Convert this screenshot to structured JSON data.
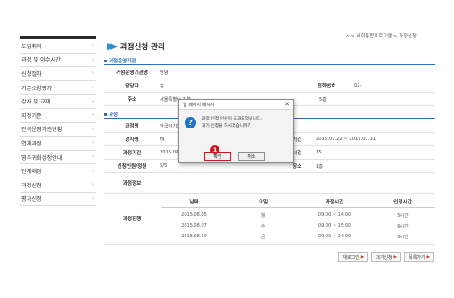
{
  "breadcrumb": "⌂ > 사회통합프로그램 > 과정신청",
  "page_title": "과정신청 관리",
  "sidebar": {
    "items": [
      {
        "label": "도입취지"
      },
      {
        "label": "과정 및 이수시간"
      },
      {
        "label": "신청절차"
      },
      {
        "label": "기본소양평가"
      },
      {
        "label": "강사 및 교재"
      },
      {
        "label": "지정기준"
      },
      {
        "label": "전국운영기관현황"
      },
      {
        "label": "연계과정"
      },
      {
        "label": "영주귀화심청안내"
      },
      {
        "label": "단계배정"
      },
      {
        "label": "과정신청"
      },
      {
        "label": "평가신청"
      }
    ]
  },
  "institution": {
    "section_title": "거점운영기관",
    "rows": [
      {
        "label": "거점운영기관명",
        "value": "안녕"
      },
      {
        "label": "담당자",
        "value": "김",
        "label2": "전화번호",
        "value2": "02-"
      },
      {
        "label": "주소",
        "value": "서울특별시 강북",
        "value2": "5층"
      }
    ]
  },
  "course": {
    "section_title": "과정",
    "rows": [
      {
        "label": "과정명",
        "value": "한국어기초"
      },
      {
        "label": "강사명",
        "value": "HJ",
        "label2": "기간",
        "value2": "2015.07.22 ~ 2015.07.31"
      },
      {
        "label": "과정기간",
        "value": "2015.08.05",
        "label2": "시간",
        "value2": "15"
      },
      {
        "label": "신청인원/정원",
        "value": "5/5",
        "label2": "장소",
        "value2": "1층"
      },
      {
        "label": "과정정보",
        "value": ""
      }
    ]
  },
  "schedule": {
    "label": "과정진행",
    "headers": [
      "날짜",
      "요일",
      "과정시간",
      "인정시간"
    ],
    "rows": [
      [
        "2015.08.05",
        "월",
        "09:00 ~ 14:00",
        "5시간"
      ],
      [
        "2015.08.07",
        "수",
        "09:00 ~ 15:00",
        "6시간"
      ],
      [
        "2015.08.20",
        "금",
        "09:00 ~ 14:00",
        "5시간"
      ]
    ]
  },
  "bottom_buttons": [
    "재로그인",
    "대기신청",
    "목록가기"
  ],
  "dialog": {
    "title": "웹 페이지 메시지",
    "close": "✕",
    "line1": "과정 신청 인원이 초과되었습니다.",
    "line2": "대기 신청을 하시겠습니까?",
    "ok": "확인",
    "cancel": "취소",
    "marker": "1"
  },
  "colors": {
    "accent": "#2a6fb8",
    "marker": "#d1161c",
    "icon": "#1e73c9"
  }
}
